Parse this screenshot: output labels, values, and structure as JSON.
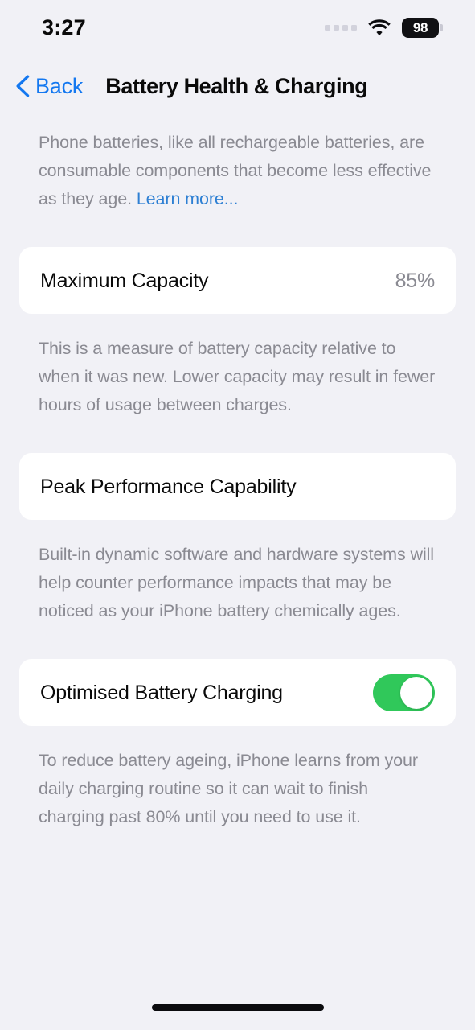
{
  "status_bar": {
    "time": "3:27",
    "battery_level": "98",
    "wifi_icon": "wifi-icon",
    "cellular_icon": "cellular-dots-icon"
  },
  "nav": {
    "back_label": "Back",
    "back_icon": "chevron-left-icon",
    "title": "Battery Health & Charging"
  },
  "intro": {
    "text": "Phone batteries, like all rechargeable batteries, are consumable components that become less effective as they age. ",
    "link_label": "Learn more..."
  },
  "sections": {
    "maximum_capacity": {
      "label": "Maximum Capacity",
      "value": "85%",
      "footnote": "This is a measure of battery capacity relative to when it was new. Lower capacity may result in fewer hours of usage between charges."
    },
    "peak_performance": {
      "label": "Peak Performance Capability",
      "footnote": "Built-in dynamic software and hardware systems will help counter performance impacts that may be noticed as your iPhone battery chemically ages."
    },
    "optimised_charging": {
      "label": "Optimised Battery Charging",
      "toggle_state": "on",
      "footnote": "To reduce battery ageing, iPhone learns from your daily charging routine so it can wait to finish charging past 80% until you need to use it."
    }
  },
  "colors": {
    "page_background": "#f1f1f6",
    "card_background": "#ffffff",
    "accent_blue": "#1478f0",
    "link_blue": "#2d7fd3",
    "toggle_green": "#30c85a",
    "secondary_text": "#8a8a92",
    "primary_text": "#0a0a0a"
  }
}
